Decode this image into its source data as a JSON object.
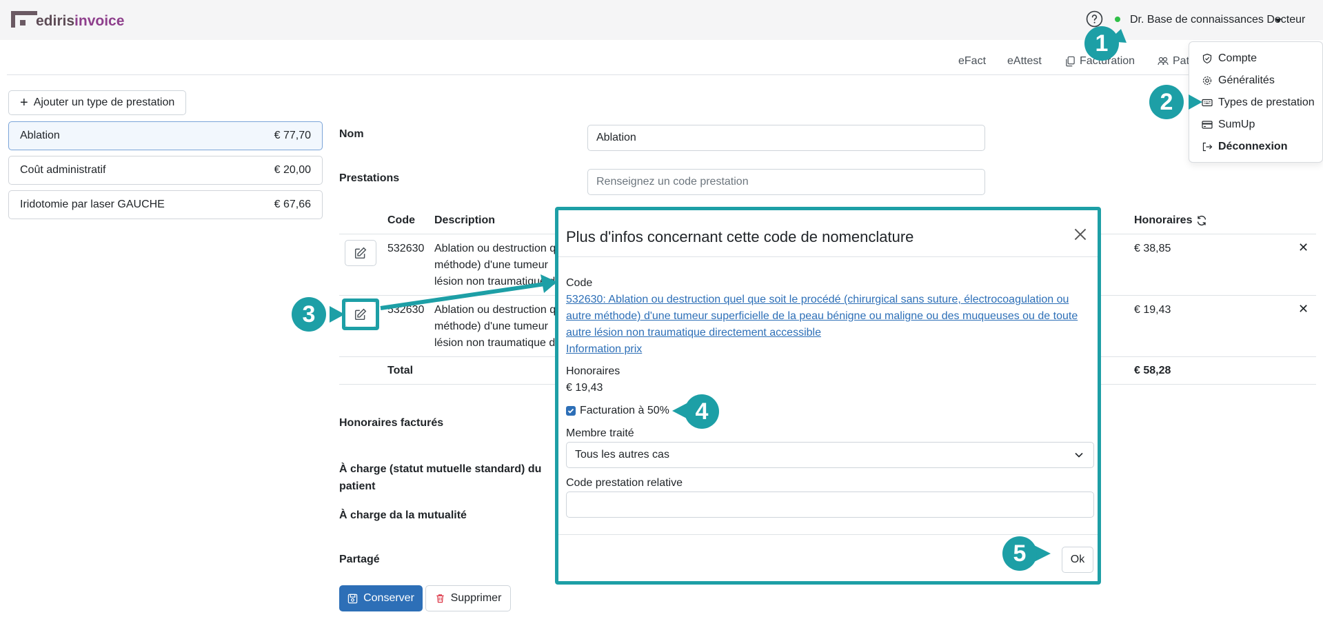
{
  "app": {
    "logo_part1": "ediris",
    "logo_part2": "invoice"
  },
  "topbar": {
    "user_name": "Dr. Base de connaissances Docteur"
  },
  "nav": {
    "items": [
      "eFact",
      "eAttest",
      "Facturation",
      "Pati"
    ]
  },
  "dropdown": {
    "items": [
      "Compte",
      "Généralités",
      "Types de prestation",
      "SumUp",
      "Déconnexion"
    ]
  },
  "sidebar": {
    "add_button": "Ajouter un type de prestation",
    "types": [
      {
        "name": "Ablation",
        "price": "€ 77,70"
      },
      {
        "name": "Coût administratif",
        "price": "€ 20,00"
      },
      {
        "name": "Iridotomie par laser GAUCHE",
        "price": "€ 67,66"
      }
    ]
  },
  "form": {
    "nom_label": "Nom",
    "nom_value": "Ablation",
    "prestations_label": "Prestations",
    "prestations_placeholder": "Renseignez un code prestation",
    "table": {
      "col_code": "Code",
      "col_description": "Description",
      "col_honoraires": "Honoraires",
      "rows": [
        {
          "code": "532630",
          "desc_line1": "Ablation ou destruction q",
          "desc_line2": "méthode) d'une tumeur",
          "desc_line3": "lésion non traumatique d",
          "honoraires": "€ 38,85"
        },
        {
          "code": "532630",
          "desc_line1": "Ablation ou destruction q",
          "desc_line2": "méthode) d'une tumeur",
          "desc_line3": "lésion non traumatique d",
          "honoraires": "€ 19,43"
        }
      ],
      "total_label": "Total",
      "total_value": "€ 58,28"
    },
    "honoraires_factures": "Honoraires facturés",
    "a_charge_patient_1": "À charge (statut mutuelle standard) du",
    "a_charge_patient_2": "patient",
    "a_charge_mutualite": "À charge da la mutualité",
    "partage": "Partagé",
    "save_button": "Conserver",
    "delete_button": "Supprimer"
  },
  "modal": {
    "title": "Plus d'infos concernant cette code de nomenclature",
    "code_label": "Code",
    "code_link_1": "532630: Ablation ou destruction quel que soit le procédé (chirurgical sans suture, électrocoagulation ou",
    "code_link_2": "autre méthode) d'une tumeur superficielle de la peau bénigne ou maligne ou des muqueuses ou de toute",
    "code_link_3": "autre lésion non traumatique directement accessible",
    "info_prix": "Information prix",
    "honoraires_label": "Honoraires",
    "honoraires_value": "€ 19,43",
    "facturation_label": "Facturation à 50%",
    "facturation_checked": true,
    "membre_label": "Membre traité",
    "membre_value": "Tous les autres cas",
    "code_relative_label": "Code prestation relative",
    "code_relative_value": "",
    "ok_button": "Ok"
  },
  "annotations": {
    "steps": [
      "1",
      "2",
      "3",
      "4",
      "5"
    ],
    "color": "#1d9fa6"
  }
}
